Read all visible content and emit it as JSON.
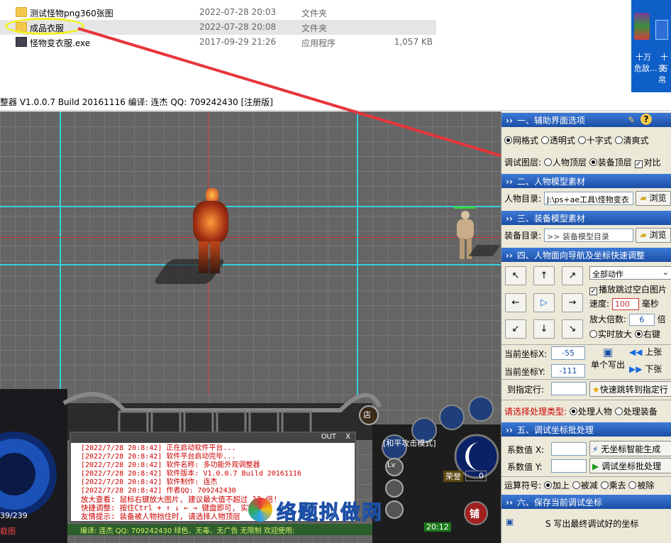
{
  "explorer": {
    "files": [
      {
        "name": "测试怪物png360张图",
        "date": "2022-07-28 20:03",
        "type": "文件夹",
        "size": "",
        "icon": "folder-icon"
      },
      {
        "name": "成品衣服",
        "date": "2022-07-28 20:08",
        "type": "文件夹",
        "size": "",
        "icon": "folder-icon"
      },
      {
        "name": "怪物变衣服.exe",
        "date": "2017-09-29 21:26",
        "type": "应用程序",
        "size": "1,057 KB",
        "icon": "exe-icon"
      }
    ]
  },
  "desktop": {
    "icon1": "十万",
    "icon1b": "危敌...",
    "icon2": "十万",
    "icon2b": "亮帛"
  },
  "window": {
    "title": "整器  V1.0.0.7 Build 20161116  编译: 连杰 QQ: 709242430 [注册版]"
  },
  "panel": {
    "s1": {
      "title": "一、辅助界面选项",
      "opts": [
        "网格式",
        "透明式",
        "十字式",
        "清爽式"
      ],
      "line2_label": "调试图层:",
      "line2_opts": [
        "人物顶层",
        "装备顶层"
      ],
      "contrast": "对比"
    },
    "s2": {
      "title": "二、人物模型素材",
      "label": "人物目录:",
      "value": "J:\\ps+ae工具\\怪物变衣",
      "browse": "浏览"
    },
    "s3": {
      "title": "三、装备模型素材",
      "label": "装备目录:",
      "value": ">> 装备模型目录",
      "browse": "浏览"
    },
    "s4": {
      "title": "四、人物面向导航及坐标快速调整",
      "arrows": [
        "↖",
        "↑",
        "↗",
        "←",
        "▷",
        "→",
        "↙",
        "↓",
        "↘"
      ],
      "action": "全部动作",
      "play_skip": "播放跳过空白图片",
      "speed_label": "速度:",
      "speed": "100",
      "speed_unit": "毫秒",
      "zoom_label": "放大倍数:",
      "zoom": "6",
      "zoom_unit": "倍",
      "realtime": "实时放大",
      "rightclick": "右键",
      "coord_x_label": "当前坐标X:",
      "coord_x": "-55",
      "coord_y_label": "当前坐标Y:",
      "coord_y": "-111",
      "single_write": "单个写出",
      "prev": "上张",
      "next": "下张",
      "goto_label": "到指定行:",
      "goto_btn": "快速跳转到指定行"
    },
    "type_label": "请选择处理类型:",
    "type_opts": [
      "处理人物",
      "处理装备"
    ],
    "s5": {
      "title": "五、调试坐标批处理",
      "x_label": "系数值 X:",
      "y_label": "系数值 Y:",
      "btn1": "无坐标智能生成",
      "btn2": "调试坐标批处理",
      "op_label": "运算符号:",
      "ops": [
        "加上",
        "被减",
        "乘去",
        "被除"
      ]
    },
    "s6": {
      "title": "六、保存当前调试坐标",
      "save": "S 写出最终调试好的坐标"
    }
  },
  "game": {
    "mode": "[和平攻击模式]",
    "honor": "荣誉",
    "honor_val": "0",
    "hp": "39/239",
    "time": "20:12",
    "lv": "Lv",
    "shop": "铺",
    "store": "店",
    "bottom_left": "截图",
    "chat": [
      "[2022/7/28 20:8:42] 正在启动软件平台...",
      "[2022/7/28 20:8:42] 软件平台启动完毕...",
      "[2022/7/28 20:8:42] 软件名称: 多功能外观调整器",
      "[2022/7/28 20:8:42] 软件版本: V1.0.0.7 Build 20161116",
      "[2022/7/28 20:8:42] 软件制作: 连杰",
      "[2022/7/28 20:8:42] 作者QQ: 709242430"
    ],
    "tips": [
      "放大查看: 鼠标右键放大图片, 建议最大值不超过 12 倍!",
      "快捷调整: 按住Ctrl + ↑ ↓ ← → 键盘即可, 实时调整",
      "友情提示: 装备被人物挡住时, 请选择人物顶层"
    ],
    "footer": "编译: 连杰  QQ: 709242430  绿色、无毒、无广告  无限制  欢迎使用:",
    "chat_tabs": [
      "OUT",
      "X"
    ],
    "watermark": "络题拟做网"
  },
  "colors": {
    "accent_blue": "#1b4ea5",
    "annotation_red": "#e8353b",
    "highlight_yellow": "#f2f21e",
    "cyan_guides": "#35d0e0"
  }
}
